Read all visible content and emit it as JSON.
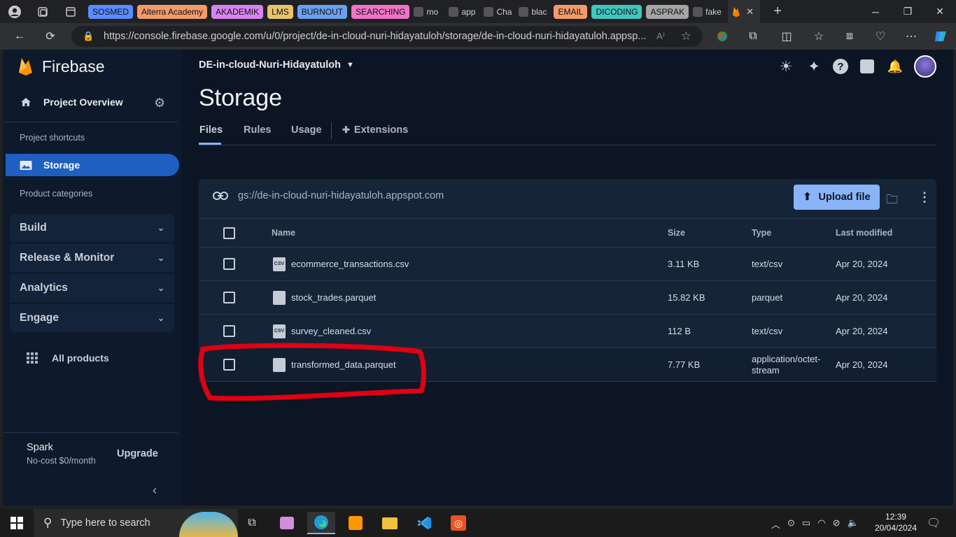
{
  "browser": {
    "tab_groups": [
      {
        "label": "SOSMED",
        "color": "#5b8cff"
      },
      {
        "label": "Alterra Academy",
        "color": "#f39a6b"
      },
      {
        "label": "AKADEMIK",
        "color": "#d884f0"
      },
      {
        "label": "LMS",
        "color": "#e8c36a"
      },
      {
        "label": "BURNOUT",
        "color": "#6aa0f0"
      },
      {
        "label": "SEARCHING",
        "color": "#f074c8"
      }
    ],
    "mini_tabs": [
      "mo",
      "app",
      "Cha",
      "blac"
    ],
    "tab_groups2": [
      {
        "label": "EMAIL",
        "color": "#f39a6b"
      },
      {
        "label": "DICODING",
        "color": "#3fc7c0"
      },
      {
        "label": "ASPRAK",
        "color": "#a5a5a5"
      }
    ],
    "mini_tabs2": [
      "fake"
    ],
    "url": "https://console.firebase.google.com/u/0/project/de-in-cloud-nuri-hidayatuloh/storage/de-in-cloud-nuri-hidayatuloh.appsp..."
  },
  "sidebar": {
    "brand": "Firebase",
    "project_overview": "Project Overview",
    "project_shortcuts": "Project shortcuts",
    "storage": "Storage",
    "product_categories": "Product categories",
    "categories": [
      "Build",
      "Release & Monitor",
      "Analytics",
      "Engage"
    ],
    "all_products": "All products",
    "plan_name": "Spark",
    "plan_desc": "No-cost $0/month",
    "upgrade": "Upgrade"
  },
  "header": {
    "project": "DE-in-cloud-Nuri-Hidayatuloh",
    "title": "Storage",
    "tabs": [
      "Files",
      "Rules",
      "Usage",
      "Extensions"
    ]
  },
  "storage": {
    "bucket": "gs://de-in-cloud-nuri-hidayatuloh.appspot.com",
    "upload": "Upload file",
    "columns": {
      "name": "Name",
      "size": "Size",
      "type": "Type",
      "modified": "Last modified"
    },
    "files": [
      {
        "name": "ecommerce_transactions.csv",
        "icon": "csv",
        "size": "3.11 KB",
        "type": "text/csv",
        "type2": "",
        "modified": "Apr 20, 2024"
      },
      {
        "name": "stock_trades.parquet",
        "icon": "file",
        "size": "15.82 KB",
        "type": "parquet",
        "type2": "",
        "modified": "Apr 20, 2024"
      },
      {
        "name": "survey_cleaned.csv",
        "icon": "csv",
        "size": "112 B",
        "type": "text/csv",
        "type2": "",
        "modified": "Apr 20, 2024"
      },
      {
        "name": "transformed_data.parquet",
        "icon": "file",
        "size": "7.77 KB",
        "type": "application/octet-",
        "type2": "stream",
        "modified": "Apr 20, 2024"
      }
    ]
  },
  "taskbar": {
    "search_placeholder": "Type here to search",
    "time": "12:39",
    "date": "20/04/2024"
  }
}
